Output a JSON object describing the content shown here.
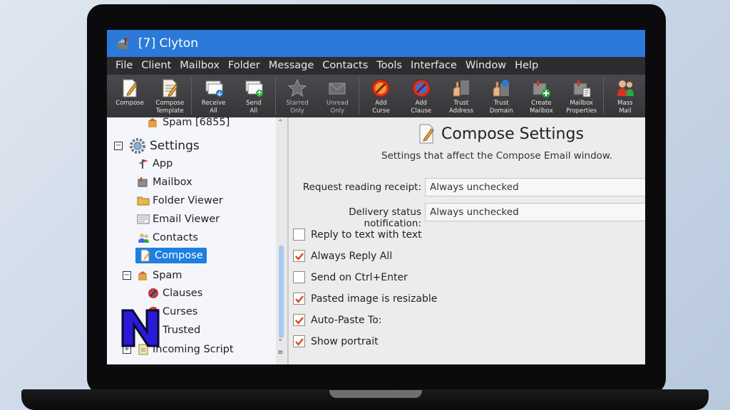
{
  "window": {
    "title": "[7] Clyton"
  },
  "menu": [
    "File",
    "Client",
    "Mailbox",
    "Folder",
    "Message",
    "Contacts",
    "Tools",
    "Interface",
    "Window",
    "Help"
  ],
  "toolbar": [
    {
      "label": "Compose",
      "icon": "compose-icon"
    },
    {
      "label": "Compose\nTemplate",
      "icon": "compose-template-icon"
    },
    {
      "label": "Receive\nAll",
      "icon": "receive-all-icon"
    },
    {
      "label": "Send\nAll",
      "icon": "send-all-icon"
    },
    {
      "label": "Starred\nOnly",
      "icon": "star-icon"
    },
    {
      "label": "Unread\nOnly",
      "icon": "unread-icon"
    },
    {
      "label": "Add\nCurse",
      "icon": "add-curse-icon"
    },
    {
      "label": "Add\nClause",
      "icon": "add-clause-icon"
    },
    {
      "label": "Trust\nAddress",
      "icon": "trust-address-icon"
    },
    {
      "label": "Trust\nDomain",
      "icon": "trust-domain-icon"
    },
    {
      "label": "Create\nMailbox",
      "icon": "create-mailbox-icon"
    },
    {
      "label": "Mailbox\nProperties",
      "icon": "mailbox-properties-icon"
    },
    {
      "label": "Mass\nMail",
      "icon": "mass-mail-icon"
    }
  ],
  "sidebar": {
    "items": [
      {
        "label": "Spam [6855]",
        "icon": "spam-icon"
      },
      {
        "label": "Settings",
        "icon": "settings-icon",
        "expander": "−"
      },
      {
        "label": "App",
        "icon": "app-icon"
      },
      {
        "label": "Mailbox",
        "icon": "mailbox-icon"
      },
      {
        "label": "Folder Viewer",
        "icon": "folder-viewer-icon"
      },
      {
        "label": "Email Viewer",
        "icon": "email-viewer-icon"
      },
      {
        "label": "Contacts",
        "icon": "contacts-icon"
      },
      {
        "label": "Compose",
        "icon": "compose-icon",
        "selected": true
      },
      {
        "label": "Spam",
        "icon": "spam-icon",
        "expander": "−"
      },
      {
        "label": "Clauses",
        "icon": "clauses-icon"
      },
      {
        "label": "Curses",
        "icon": "curses-icon"
      },
      {
        "label": "Trusted",
        "icon": "trusted-icon"
      },
      {
        "label": "Incoming Script",
        "icon": "incoming-script-icon",
        "expander": "+"
      }
    ]
  },
  "compose_settings": {
    "title": "Compose Settings",
    "subtitle": "Settings that affect the Compose Email window.",
    "fields": [
      {
        "label": "Request reading receipt:",
        "value": "Always unchecked"
      },
      {
        "label": "Delivery status notification:",
        "value": "Always unchecked"
      }
    ],
    "checkboxes": [
      {
        "label": "Reply to text with text",
        "checked": false
      },
      {
        "label": "Always Reply All",
        "checked": true
      },
      {
        "label": "Send on Ctrl+Enter",
        "checked": false
      },
      {
        "label": "Pasted image is resizable",
        "checked": true
      },
      {
        "label": "Auto-Paste To:",
        "checked": true
      },
      {
        "label": "Show portrait",
        "checked": true
      }
    ]
  },
  "colors": {
    "titlebar": "#2b79d8",
    "selection": "#1e7fe0",
    "check": "#d9481c",
    "logo": "#2a1ad8"
  }
}
